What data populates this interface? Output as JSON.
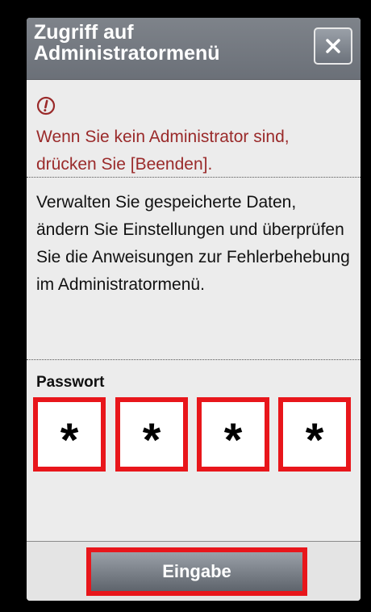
{
  "dialog": {
    "title": "Zugriff auf Administratormenü",
    "close_icon": "close-icon"
  },
  "warning": {
    "icon": "alert-icon",
    "text": "Wenn Sie kein Administrator sind, drücken Sie [Beenden]."
  },
  "description": "Verwalten Sie gespeicherte Daten, ändern Sie Einstellungen und überprüfen Sie die Anweisungen zur Fehlerbehebung im Administratormenü.",
  "password": {
    "label": "Passwort",
    "digits": [
      "*",
      "*",
      "*",
      "*"
    ]
  },
  "footer": {
    "enter_label": "Eingabe"
  },
  "colors": {
    "highlight": "#e8161b",
    "warning_text": "#9a2a2a",
    "titlebar": "#747980"
  }
}
